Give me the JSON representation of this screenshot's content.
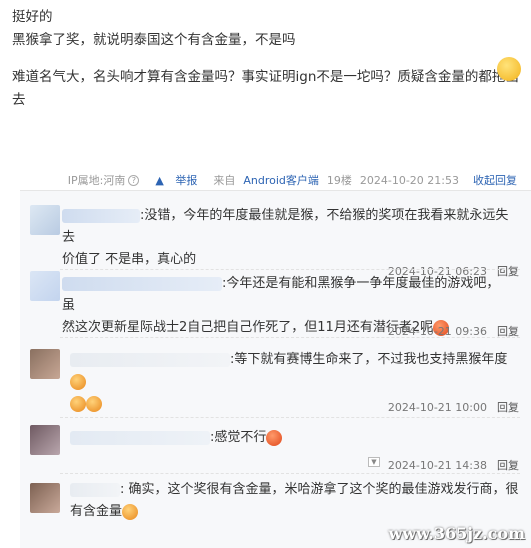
{
  "post": {
    "line1": "挺好的",
    "line2": "黑猴拿了奖，就说明泰国这个有含金量，不是吗",
    "line3": "难道名气大，名头响才算有含金量吗？事实证明ign不是一坨吗？质疑含金量的都拖出去"
  },
  "meta": {
    "ip": "IP属地:河南",
    "report": "举报",
    "source_prefix": "来自",
    "source": "Android客户端",
    "floor": "19楼",
    "time": "2024-10-20 21:53",
    "collapse": "收起回复"
  },
  "replies": [
    {
      "text1": ":没错，今年的年度最佳就是猴，不给猴的奖项在我看来就永远失去",
      "text2": "价值了 不是串，真心的",
      "time": "2024-10-21 06:23",
      "reply_label": "回复"
    },
    {
      "text1": ":今年还是有能和黑猴争一争年度最佳的游戏吧，虽",
      "text2": "然这次更新星际战士2自己把自己作死了，但11月还有潜行者2呢",
      "time": "2024-10-21 09:36",
      "reply_label": "回复"
    },
    {
      "text1": ":等下就有赛博生命来了，不过我也支持黑猴年度",
      "time": "2024-10-21 10:00",
      "reply_label": "回复"
    },
    {
      "text1": ":感觉不行",
      "time": "2024-10-21 14:38",
      "reply_label": "回复"
    },
    {
      "text1": ": 确实，这个奖很有含金量，米哈游拿了这个奖的最佳游戏发行商，很",
      "text2": "有含金量"
    }
  ],
  "watermark": "www.365jz.com",
  "icons": {
    "report": "report-icon",
    "question": "help-icon",
    "dropdown": "dropdown-arrow-icon"
  }
}
